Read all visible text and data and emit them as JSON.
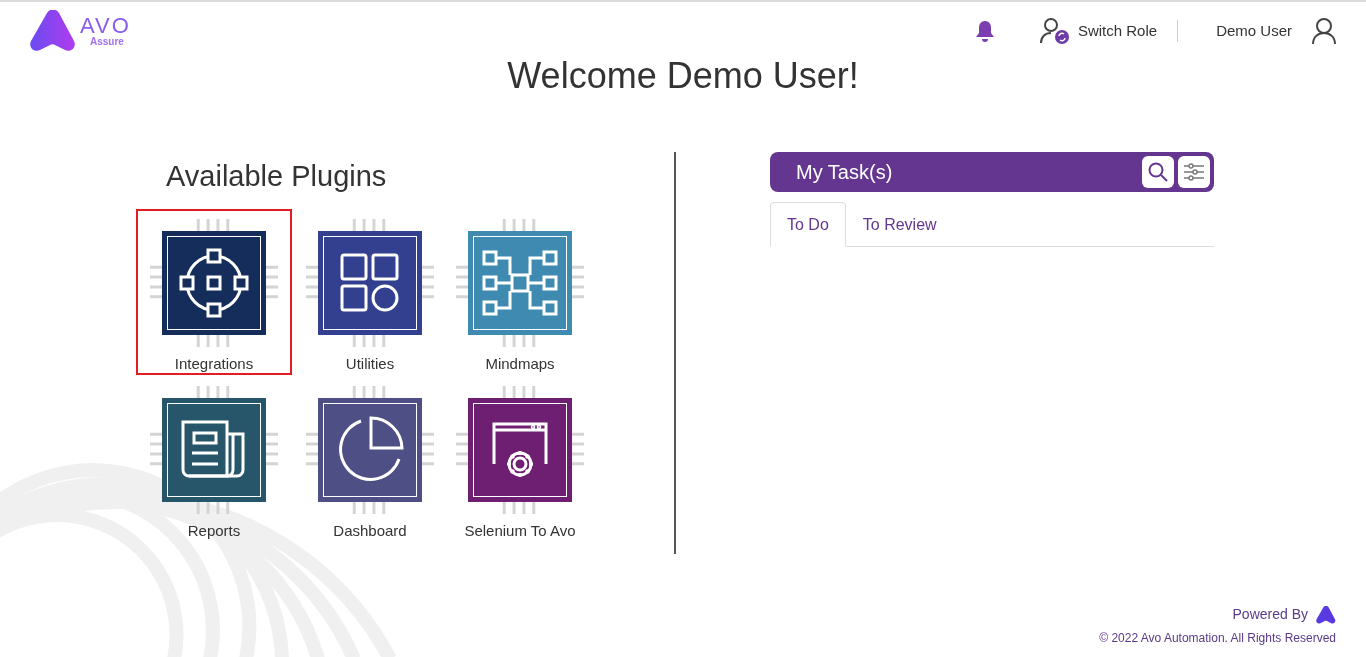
{
  "logo": {
    "name": "AVO",
    "subtitle": "Assure"
  },
  "header": {
    "switch_role": "Switch Role",
    "user": "Demo User"
  },
  "welcome": "Welcome Demo User!",
  "plugins": {
    "title": "Available Plugins",
    "items": [
      {
        "label": "Integrations",
        "color": "#142d5a",
        "selected": true
      },
      {
        "label": "Utilities",
        "color": "#32408f",
        "selected": false
      },
      {
        "label": "Mindmaps",
        "color": "#3e8ab1",
        "selected": false
      },
      {
        "label": "Reports",
        "color": "#27566b",
        "selected": false
      },
      {
        "label": "Dashboard",
        "color": "#4e4f85",
        "selected": false
      },
      {
        "label": "Selenium To Avo",
        "color": "#6f1f72",
        "selected": false
      }
    ]
  },
  "tasks": {
    "title": "My Task(s)",
    "tabs": [
      {
        "label": "To Do",
        "selected": true
      },
      {
        "label": "To Review",
        "selected": false
      }
    ]
  },
  "footer": {
    "powered_by": "Powered By",
    "copyright": "© 2022 Avo Automation. All Rights Reserved"
  }
}
